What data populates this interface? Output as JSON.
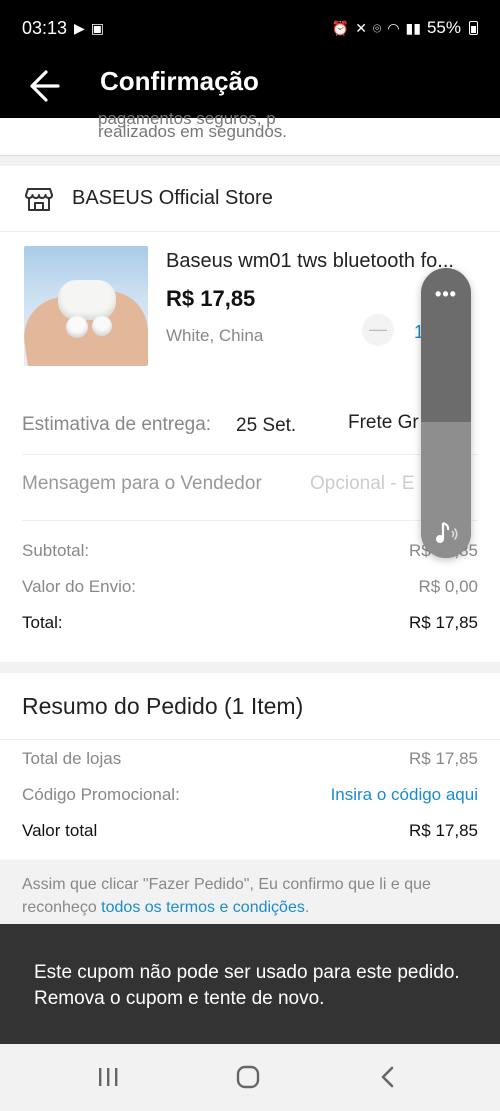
{
  "status_bar": {
    "time": "03:13",
    "battery": "55%"
  },
  "app_bar": {
    "title": "Confirmação"
  },
  "top_note": {
    "line1": "pagamentos seguros, p",
    "line2": "realizados em segundos."
  },
  "store": {
    "name": "BASEUS Official Store",
    "product": {
      "title": "Baseus wm01 tws bluetooth fo...",
      "price": "R$ 17,85",
      "variant": "White, China",
      "quantity": "1"
    },
    "delivery": {
      "label": "Estimativa de entrega:",
      "date": "25 Set.",
      "shipping": "Frete Gr"
    },
    "message": {
      "label": "Mensagem para o Vendedor",
      "placeholder": "Opcional - E"
    },
    "subtotal": {
      "label": "Subtotal:",
      "value": "R$ 17,85"
    },
    "shipping_cost": {
      "label": "Valor do Envio:",
      "value": "R$ 0,00"
    },
    "total": {
      "label": "Total:",
      "value": "R$ 17,85"
    }
  },
  "summary": {
    "title": "Resumo do Pedido (1 Item)",
    "stores_total": {
      "label": "Total de lojas",
      "value": "R$ 17,85"
    },
    "promo": {
      "label": "Código Promocional:",
      "link": "Insira o código aqui"
    },
    "grand_total": {
      "label": "Valor total",
      "value": "R$ 17,85"
    }
  },
  "terms": {
    "text": "Assim que clicar \"Fazer Pedido\", Eu confirmo que li e que reconheço ",
    "link": "todos os termos e condições",
    "end": "."
  },
  "toast": {
    "message": "Este cupom não pode ser usado para este pedido. Remova o cupom e tente de novo."
  },
  "volume_overlay": {
    "level": 0.47,
    "menu_label": "•••"
  },
  "colors": {
    "accent": "#1a8ccd",
    "header": "#000000",
    "toast": "#333333"
  }
}
